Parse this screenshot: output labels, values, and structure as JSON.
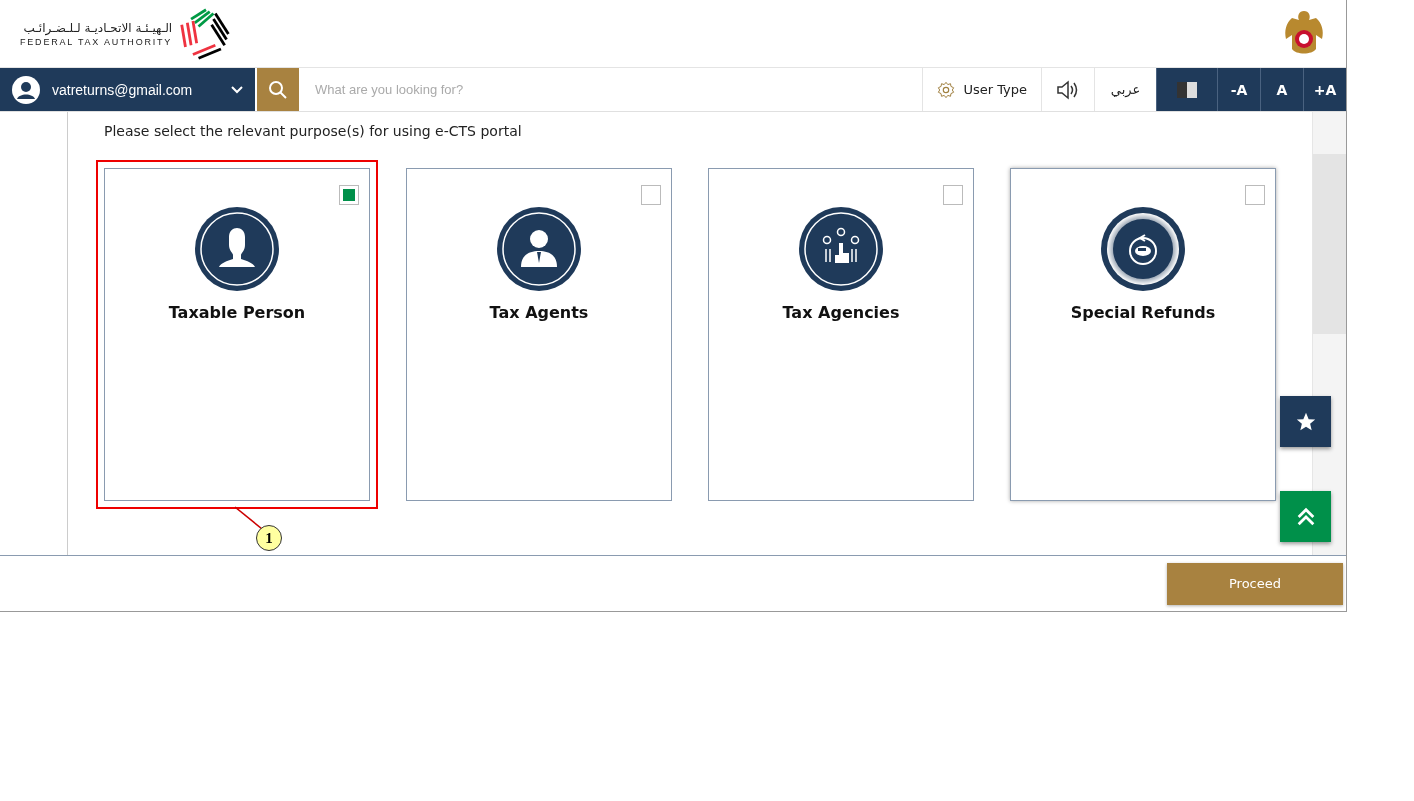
{
  "header": {
    "logo_arabic": "الـهيـئـة الاتحـاديـة لـلـضـرائـب",
    "logo_english": "FEDERAL TAX AUTHORITY"
  },
  "nav": {
    "user_email": "vatreturns@gmail.com",
    "search": {
      "placeholder": "What are you looking for?"
    },
    "user_type": "User Type",
    "language": "عربي",
    "font_buttons": [
      "-A",
      "A",
      "+A"
    ]
  },
  "prompt": "Please select the relevant purpose(s) for using e-CTS portal",
  "cards": [
    {
      "title": "Taxable Person",
      "kind": "person",
      "checked": true,
      "hovered": false,
      "annotation": "1"
    },
    {
      "title": "Tax Agents",
      "kind": "agent",
      "checked": false,
      "hovered": false
    },
    {
      "title": "Tax Agencies",
      "kind": "agencies",
      "checked": false,
      "hovered": false
    },
    {
      "title": "Special Refunds",
      "kind": "refund",
      "checked": false,
      "hovered": true
    }
  ],
  "proceed_button": "Proceed"
}
